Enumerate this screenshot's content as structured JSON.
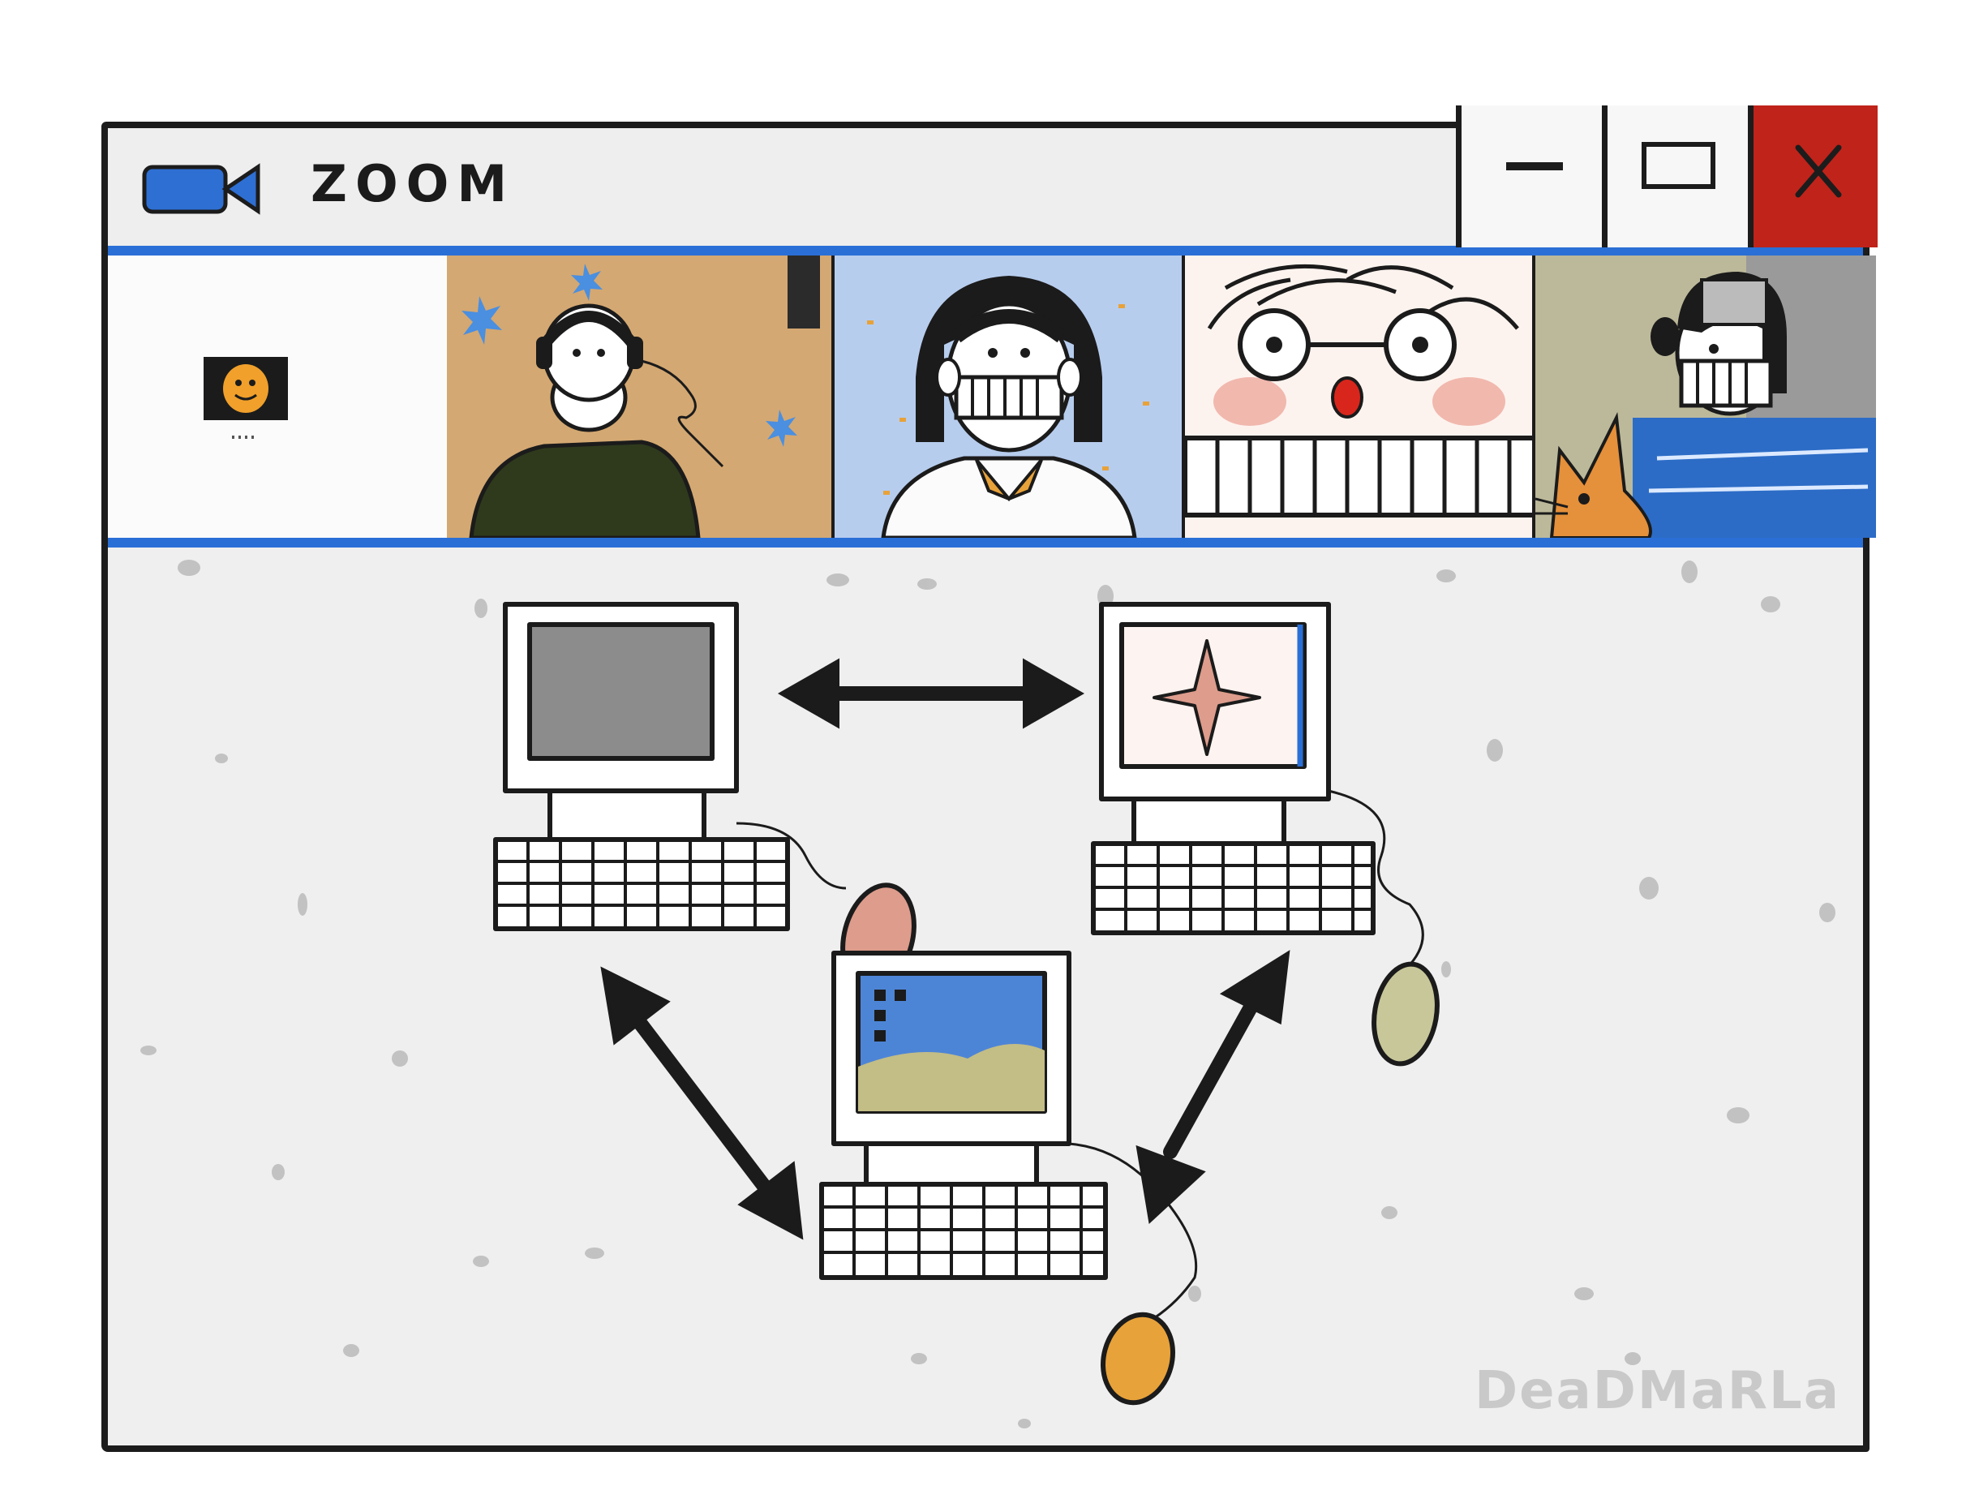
{
  "window": {
    "title": "ZOOM",
    "app_icon": "video-camera-icon",
    "controls": [
      {
        "name": "minimize",
        "icon": "minimize-icon"
      },
      {
        "name": "maximize",
        "icon": "maximize-icon"
      },
      {
        "name": "close",
        "icon": "close-icon"
      }
    ]
  },
  "participants": [
    {
      "tile": "self-view",
      "icon": "smiley-avatar-icon"
    },
    {
      "tile": "participant-headphones",
      "icon": "person-headphones-icon"
    },
    {
      "tile": "participant-collar",
      "icon": "person-icon"
    },
    {
      "tile": "participant-glasses",
      "icon": "person-glasses-icon"
    },
    {
      "tile": "participant-cat",
      "icon": "person-with-cat-icon"
    }
  ],
  "shared_content": {
    "items": [
      "computer-gray-screen",
      "computer-star-screen",
      "computer-landscape-screen"
    ],
    "connections": 3
  },
  "signature": "DeaDMaRLa",
  "colors": {
    "accent_blue": "#2a6fd6",
    "close_red": "#c0231a",
    "window_bg": "#efefef",
    "outline": "#1c1c1c"
  }
}
